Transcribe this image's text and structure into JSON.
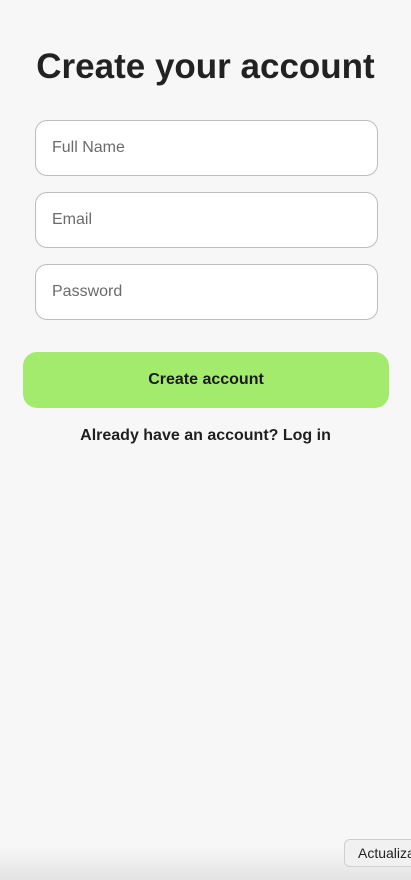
{
  "form": {
    "title": "Create your account",
    "fields": {
      "full_name": {
        "placeholder": "Full Name",
        "value": ""
      },
      "email": {
        "placeholder": "Email",
        "value": ""
      },
      "password": {
        "placeholder": "Password",
        "value": ""
      }
    },
    "submit_label": "Create account",
    "login_link_text": "Already have an account? Log in"
  },
  "overlay": {
    "update_chip_label": "Actualiza"
  },
  "colors": {
    "background": "#f7f7f7",
    "accent": "#a3eb6c",
    "field_border": "#bdbdbd",
    "text": "#222222"
  }
}
